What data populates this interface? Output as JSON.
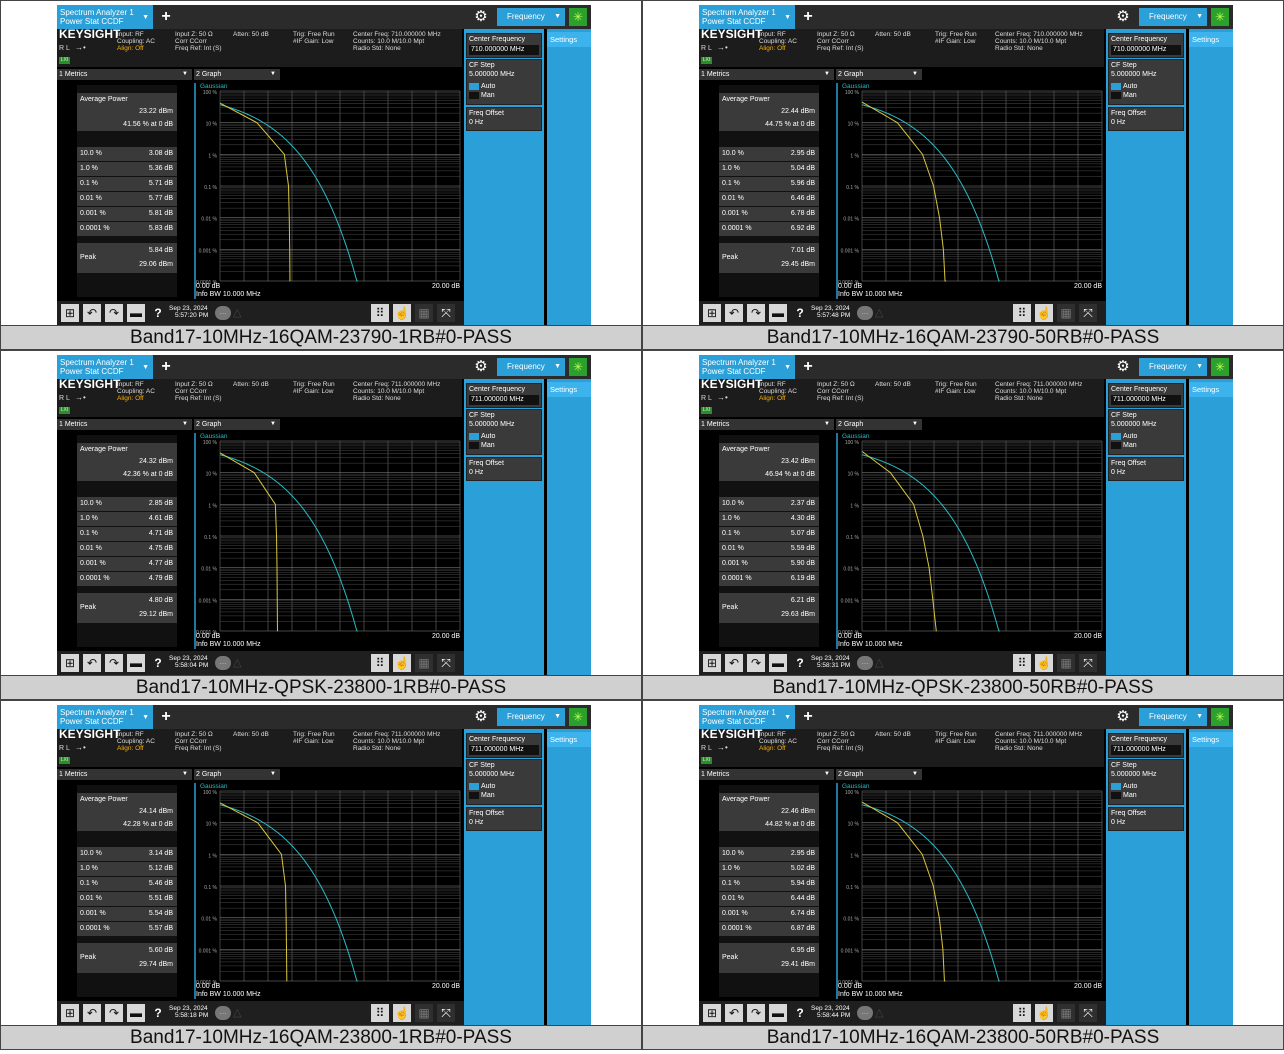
{
  "instrument": {
    "tab_line1": "Spectrum Analyzer 1",
    "tab_line2": "Power Stat CCDF",
    "add_label": "+",
    "menu_label": "Frequency",
    "settings_tab": "Settings",
    "logo": "KEYSIGHT",
    "rl": "R L",
    "lxi": "LXI",
    "col1": [
      "Input: RF",
      "Coupling: AC",
      "Align: Off"
    ],
    "col2": [
      "Input Z: 50 Ω",
      "Corr CCorr",
      "Freq Ref: Int (S)"
    ],
    "col3": [
      "Atten: 50 dB"
    ],
    "col4": [
      "Trig: Free Run",
      "#IF Gain: Low"
    ],
    "col6": [
      "Radio Std: None"
    ],
    "cf_label": "Center Frequency",
    "cf_step_label": "CF Step",
    "cf_step_value": "5.000000 MHz",
    "auto_label": "Auto",
    "man_label": "Man",
    "offset_label": "Freq Offset",
    "offset_value": "0 Hz",
    "metrics_dropdown": "1 Metrics",
    "graph_dropdown": "2 Graph",
    "gaussian_label": "Gaussian",
    "y_ticks": [
      "100 %",
      "10 %",
      "1 %",
      "0.1 %",
      "0.01 %",
      "0.001 %",
      "0.0001 %"
    ],
    "x_start": "0.00 dB",
    "x_end": "20.00 dB",
    "info_bw": "Info BW 10.000 MHz",
    "avg_power_label": "Average Power",
    "peak_label": "Peak",
    "prob_labels": [
      "10.0 %",
      "1.0 %",
      "0.1 %",
      "0.01 %",
      "0.001 %",
      "0.0001 %"
    ],
    "date_line1": "Sep 23, 2024",
    "colors": {
      "accent": "#2a9fd8",
      "trace_gaussian": "#2abcc4",
      "trace_measured": "#d9c640"
    },
    "icons": [
      "windows-icon",
      "undo-icon",
      "redo-icon",
      "folder-icon",
      "help-icon",
      "message-icon",
      "warning-icon",
      "keypad-icon",
      "touch-icon",
      "window-layout-icon",
      "fullscreen-icon",
      "gear-icon",
      "sweep-status-icon"
    ]
  },
  "panels": [
    {
      "caption": "Band17-10MHz-16QAM-23790-1RB#0-PASS",
      "cf_value": "710.000000 MHz",
      "status_center": [
        "Center Freq: 710.000000 MHz",
        "Counts: 10.0 M/10.0 Mpt"
      ],
      "avg_dbm": "23.22 dBm",
      "avg_pct": "41.56 % at 0 dB",
      "metrics": [
        "3.08 dB",
        "5.36 dB",
        "5.71 dB",
        "5.77 dB",
        "5.81 dB",
        "5.83 dB"
      ],
      "peak_db": "5.84 dB",
      "peak_dbm": "29.06 dBm",
      "time": "5:57:20 PM"
    },
    {
      "caption": "Band17-10MHz-16QAM-23790-50RB#0-PASS",
      "cf_value": "710.000000 MHz",
      "status_center": [
        "Center Freq: 710.000000 MHz",
        "Counts: 10.0 M/10.0 Mpt"
      ],
      "avg_dbm": "22.44 dBm",
      "avg_pct": "44.75 % at 0 dB",
      "metrics": [
        "2.95 dB",
        "5.04 dB",
        "5.96 dB",
        "6.46 dB",
        "6.78 dB",
        "6.92 dB"
      ],
      "peak_db": "7.01 dB",
      "peak_dbm": "29.45 dBm",
      "time": "5:57:48 PM"
    },
    {
      "caption": "Band17-10MHz-QPSK-23800-1RB#0-PASS",
      "cf_value": "711.000000 MHz",
      "status_center": [
        "Center Freq: 711.000000 MHz",
        "Counts: 10.0 M/10.0 Mpt"
      ],
      "avg_dbm": "24.32 dBm",
      "avg_pct": "42.36 % at 0 dB",
      "metrics": [
        "2.85 dB",
        "4.61 dB",
        "4.71 dB",
        "4.75 dB",
        "4.77 dB",
        "4.79 dB"
      ],
      "peak_db": "4.80 dB",
      "peak_dbm": "29.12 dBm",
      "time": "5:58:04 PM"
    },
    {
      "caption": "Band17-10MHz-QPSK-23800-50RB#0-PASS",
      "cf_value": "711.000000 MHz",
      "status_center": [
        "Center Freq: 711.000000 MHz",
        "Counts: 10.0 M/10.0 Mpt"
      ],
      "avg_dbm": "23.42 dBm",
      "avg_pct": "46.94 % at 0 dB",
      "metrics": [
        "2.37 dB",
        "4.30 dB",
        "5.07 dB",
        "5.59 dB",
        "5.90 dB",
        "6.19 dB"
      ],
      "peak_db": "6.21 dB",
      "peak_dbm": "29.63 dBm",
      "time": "5:58:31 PM"
    },
    {
      "caption": "Band17-10MHz-16QAM-23800-1RB#0-PASS",
      "cf_value": "711.000000 MHz",
      "status_center": [
        "Center Freq: 711.000000 MHz",
        "Counts: 10.0 M/10.0 Mpt"
      ],
      "avg_dbm": "24.14 dBm",
      "avg_pct": "42.28 % at 0 dB",
      "metrics": [
        "3.14 dB",
        "5.12 dB",
        "5.46 dB",
        "5.51 dB",
        "5.54 dB",
        "5.57 dB"
      ],
      "peak_db": "5.60 dB",
      "peak_dbm": "29.74 dBm",
      "time": "5:58:18 PM"
    },
    {
      "caption": "Band17-10MHz-16QAM-23800-50RB#0-PASS",
      "cf_value": "711.000000 MHz",
      "status_center": [
        "Center Freq: 711.000000 MHz",
        "Counts: 10.0 M/10.0 Mpt"
      ],
      "avg_dbm": "22.46 dBm",
      "avg_pct": "44.82 % at 0 dB",
      "metrics": [
        "2.95 dB",
        "5.02 dB",
        "5.94 dB",
        "6.44 dB",
        "6.74 dB",
        "6.87 dB"
      ],
      "peak_db": "6.95 dB",
      "peak_dbm": "29.41 dBm",
      "time": "5:58:44 PM"
    }
  ]
}
